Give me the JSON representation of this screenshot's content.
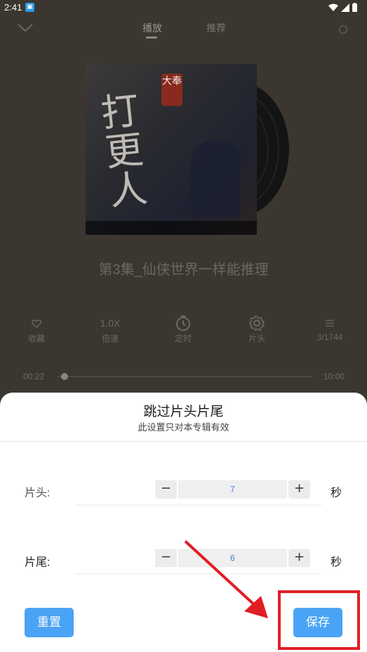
{
  "status_bar": {
    "time": "2:41"
  },
  "header": {
    "tabs": [
      {
        "label": "播放"
      },
      {
        "label": "推荐"
      }
    ],
    "icons": {
      "back": "chevron-down-icon",
      "info": "info-icon"
    }
  },
  "cover": {
    "seal_text": "大奉",
    "title_art": "打更人"
  },
  "episode_title": "第3集_仙侠世界一样能推理",
  "controls": {
    "favorite": {
      "label": "收藏",
      "icon": "heart-icon"
    },
    "speed": {
      "value": "1.0X",
      "label": "倍速"
    },
    "timer": {
      "label": "定时",
      "icon": "timer-icon"
    },
    "intro": {
      "label": "片头",
      "icon": "gear-icon"
    },
    "playlist": {
      "label": "3/1744",
      "icon": "list-icon"
    }
  },
  "progress": {
    "current": "00:22",
    "total": "10:00",
    "fraction": 0.037
  },
  "sheet": {
    "title": "跳过片头片尾",
    "subtitle": "此设置只对本专辑有效",
    "intro_row": {
      "label": "片头:",
      "value": "7",
      "minus": "−",
      "plus": "+",
      "unit": "秒"
    },
    "outro_row": {
      "label": "片尾:",
      "value": "6",
      "minus": "−",
      "plus": "+",
      "unit": "秒"
    },
    "reset_label": "重置",
    "save_label": "保存"
  },
  "colors": {
    "accent": "#4aa3f4",
    "annotation": "#e11e25"
  }
}
